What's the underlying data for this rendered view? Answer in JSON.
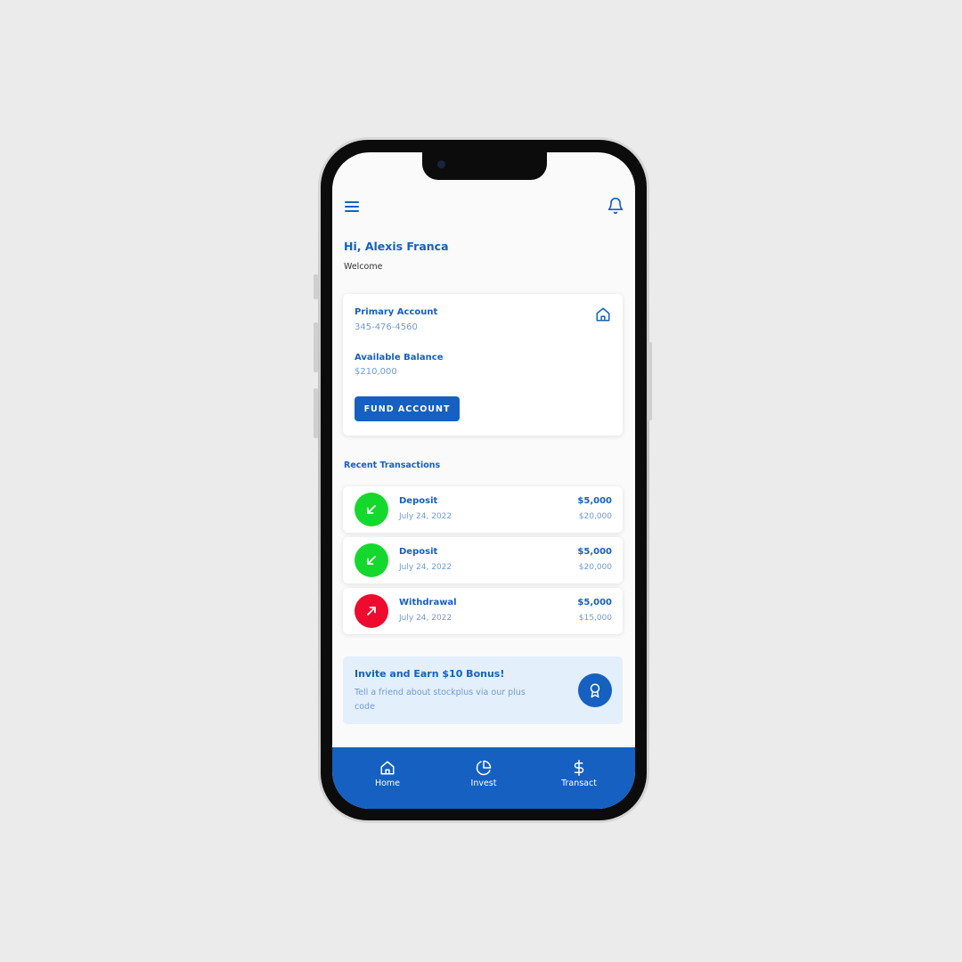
{
  "header": {
    "greeting": "Hi, Alexis Franca",
    "welcome": "Welcome"
  },
  "account": {
    "title": "Primary Account",
    "number": "345-476-4560",
    "balance_label": "Available Balance",
    "balance_value": "$210,000",
    "fund_button": "FUND ACCOUNT"
  },
  "transactions": {
    "title": "Recent Transactions",
    "items": [
      {
        "type": "Deposit",
        "date": "July 24, 2022",
        "amount": "$5,000",
        "balance": "$20,000",
        "color": "#14d92c"
      },
      {
        "type": "Deposit",
        "date": "July 24, 2022",
        "amount": "$5,000",
        "balance": "$20,000",
        "color": "#14d92c"
      },
      {
        "type": "Withdrawal",
        "date": "July 24, 2022",
        "amount": "$5,000",
        "balance": "$15,000",
        "color": "#ee0b2e"
      }
    ]
  },
  "invite": {
    "title": "Invite and Earn $10 Bonus!",
    "text": "Tell a friend about stockplus via our plus code"
  },
  "nav": {
    "home": "Home",
    "invest": "Invest",
    "transact": "Transact"
  },
  "colors": {
    "brand": "#1560c1",
    "deposit": "#14d92c",
    "withdrawal": "#ee0b2e",
    "invite_bg": "#e3effb"
  }
}
